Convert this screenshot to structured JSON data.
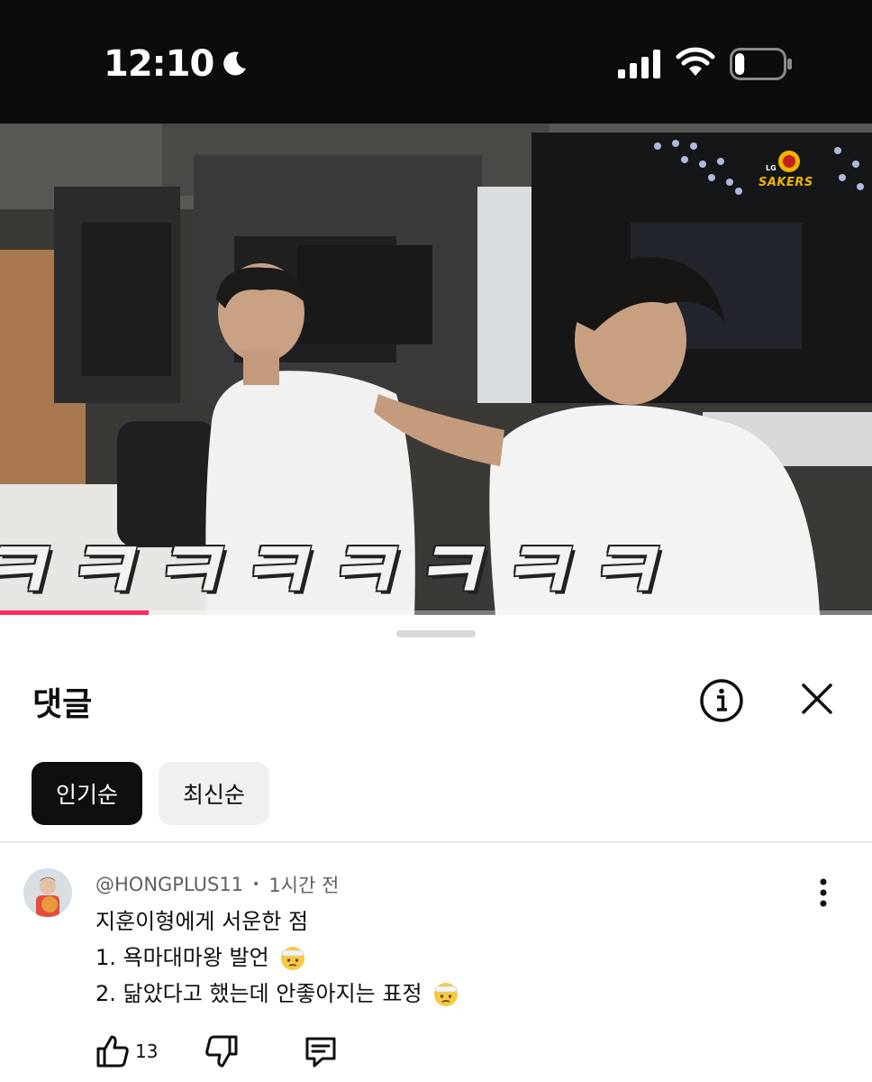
{
  "status_bar": {
    "time": "12:10",
    "icons": [
      "moon-icon",
      "signal-icon",
      "wifi-icon",
      "battery-icon"
    ],
    "battery_level": 0.2
  },
  "video": {
    "caption": "ㅋㅋㅋㅋㅋㅋㅋㅋ",
    "logo_small": "LG",
    "logo_text": "SAKERS",
    "progress": 0.17,
    "progress_color": "#ff2a5c"
  },
  "comments_sheet": {
    "title": "댓글",
    "sort_options": [
      {
        "label": "인기순",
        "selected": true
      },
      {
        "label": "최신순",
        "selected": false
      }
    ],
    "header_icons": [
      "info-icon",
      "close-icon"
    ]
  },
  "comments": [
    {
      "author": "@HONGPLUS11",
      "separator": "•",
      "time_ago": "1시간 전",
      "lines": [
        "지훈이형에게 서운한 점",
        "1. 욕마대마왕 발언",
        "2. 닮았다고 했는데 안좋아지는 표정"
      ],
      "line_emojis": [
        "",
        "face-with-head-bandage",
        "face-with-head-bandage"
      ],
      "likes": "13",
      "actions": [
        "thumbs-up-icon",
        "thumbs-down-icon",
        "reply-icon"
      ]
    }
  ]
}
